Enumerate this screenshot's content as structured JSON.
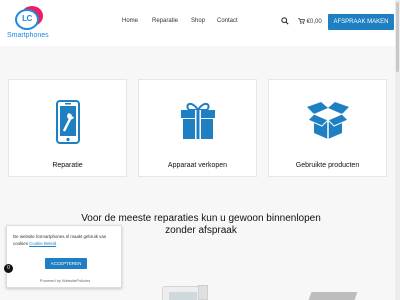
{
  "header": {
    "logo": {
      "letters": "LC",
      "word": "Smartphones"
    },
    "nav": [
      "Home",
      "Reparatie",
      "Shop",
      "Contact"
    ],
    "cart_total": "€0,00",
    "cta_label": "AFSPRAAK MAKEN"
  },
  "cards": [
    {
      "icon": "phone-repair-icon",
      "label": "Reparatie"
    },
    {
      "icon": "gift-icon",
      "label": "Apparaat verkopen"
    },
    {
      "icon": "box-icon",
      "label": "Gebruikte producten"
    }
  ],
  "headline": "Voor de meeste reparaties kun u gewoon binnenlopen zonder afspraak",
  "cookie": {
    "text": "De website lcsmartphones.nl maakt gebruik van cookies",
    "link": "Cookie Beleid",
    "button": "ACCEPTEREN",
    "powered": "Powered by WebsitePolicies",
    "badge": "0"
  },
  "colors": {
    "brand_blue": "#1e7fc2",
    "logo_pink": "#e91e63",
    "background": "#f7f7f7"
  }
}
